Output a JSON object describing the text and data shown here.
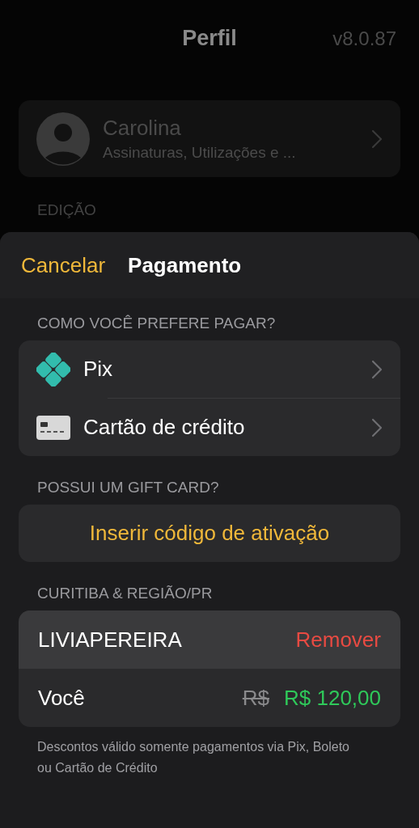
{
  "background": {
    "title": "Perfil",
    "version": "v8.0.87",
    "profile": {
      "name": "Carolina",
      "subtitle": "Assinaturas, Utilizações e ..."
    },
    "section": "EDIÇÃO"
  },
  "sheet": {
    "cancel": "Cancelar",
    "title": "Pagamento",
    "payment_header": "COMO VOCÊ PREFERE PAGAR?",
    "payment_methods": [
      {
        "kind": "pix",
        "label": "Pix"
      },
      {
        "kind": "card",
        "label": "Cartão de crédito"
      }
    ],
    "gift_header": "POSSUI UM GIFT CARD?",
    "gift_button": "Inserir código de ativação",
    "coupon_header": "CURITIBA & REGIÃO/PR",
    "coupon": {
      "code": "LIVIAPEREIRA",
      "remove": "Remover"
    },
    "price": {
      "label": "Você",
      "old": "R$",
      "new": "R$ 120,00"
    },
    "note": "Descontos válido somente pagamentos via Pix, Boleto ou Cartão de Crédito"
  }
}
